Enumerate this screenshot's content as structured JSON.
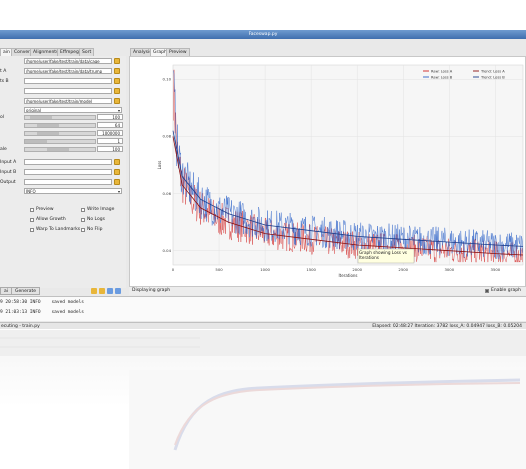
{
  "window": {
    "title": "Faceswap.py"
  },
  "left_tabs": [
    "ain",
    "Convert",
    "Alignments",
    "Effmpeg",
    "Sort"
  ],
  "right_tabs": [
    "Analysis",
    "Graph",
    "Preview"
  ],
  "fields": [
    {
      "label": "",
      "value": "/home/user/fake/test/train/data/cage"
    },
    {
      "label": "t A",
      "value": "/home/user/fake/test/train/data/trump"
    },
    {
      "label": "ts B",
      "value": ""
    },
    {
      "label": "",
      "value": ""
    },
    {
      "label": "",
      "value": "/home/user/fake/test/train/model"
    }
  ],
  "trainer_value": "original",
  "sliders": [
    {
      "label": "ol",
      "value": "100",
      "knob": 0.1
    },
    {
      "label": "",
      "value": "64",
      "knob": 0.25
    },
    {
      "label": "",
      "value": "1000000",
      "knob": 0.25
    },
    {
      "label": "",
      "value": "1",
      "knob": 0.0
    },
    {
      "label": "ale",
      "value": "100",
      "knob": 0.45
    }
  ],
  "io_fields": [
    {
      "label": "Input A",
      "value": ""
    },
    {
      "label": "Input B",
      "value": ""
    },
    {
      "label": "Output",
      "value": ""
    }
  ],
  "loglevel": "INFO",
  "checkboxes": [
    {
      "label": "Preview"
    },
    {
      "label": "Write Image"
    },
    {
      "label": "Allow Growth"
    },
    {
      "label": "No Logs"
    },
    {
      "label": "Warp To Landmarks"
    },
    {
      "label": "No Flip"
    }
  ],
  "buttons": {
    "train": "ai",
    "generate": "Generate"
  },
  "chart_data": {
    "type": "line",
    "title": "",
    "xlabel": "Iterations",
    "ylabel": "Loss",
    "xlim": [
      0,
      3800
    ],
    "ylim": [
      0.035,
      0.105
    ],
    "xticks": [
      "0",
      "500",
      "1000",
      "1500",
      "2000",
      "2500",
      "3000",
      "3500"
    ],
    "yticks": [
      "0.04",
      "0.06",
      "0.08",
      "0.10"
    ],
    "legend": [
      "Raw: Loss A",
      "Raw: Loss B",
      "Trend: Loss A",
      "Trend: Loss B"
    ],
    "tooltip": "Graph showing Loss vs Iterations",
    "series": [
      {
        "name": "Raw: Loss A",
        "color": "#d02020",
        "x": [
          0,
          50,
          100,
          200,
          300,
          500,
          700,
          1000,
          1500,
          2000,
          2500,
          3000,
          3500,
          3800
        ],
        "y": [
          0.1,
          0.072,
          0.064,
          0.058,
          0.055,
          0.051,
          0.049,
          0.046,
          0.044,
          0.042,
          0.041,
          0.04,
          0.039,
          0.0385
        ]
      },
      {
        "name": "Raw: Loss B",
        "color": "#2a60c8",
        "x": [
          0,
          50,
          100,
          200,
          300,
          500,
          700,
          1000,
          1500,
          2000,
          2500,
          3000,
          3500,
          3800
        ],
        "y": [
          0.098,
          0.074,
          0.067,
          0.061,
          0.058,
          0.054,
          0.052,
          0.049,
          0.047,
          0.045,
          0.044,
          0.043,
          0.042,
          0.0415
        ]
      },
      {
        "name": "Trend: Loss A",
        "color": "#8b1010",
        "x": [
          0,
          100,
          300,
          600,
          1000,
          1500,
          2000,
          2500,
          3000,
          3500,
          3800
        ],
        "y": [
          0.08,
          0.063,
          0.055,
          0.05,
          0.046,
          0.044,
          0.042,
          0.041,
          0.04,
          0.039,
          0.0385
        ]
      },
      {
        "name": "Trend: Loss B",
        "color": "#1a3d8c",
        "x": [
          0,
          100,
          300,
          600,
          1000,
          1500,
          2000,
          2500,
          3000,
          3500,
          3800
        ],
        "y": [
          0.082,
          0.066,
          0.058,
          0.053,
          0.049,
          0.047,
          0.045,
          0.044,
          0.043,
          0.042,
          0.0415
        ]
      }
    ]
  },
  "status": {
    "left": "Displaying graph",
    "right": "Enable graph"
  },
  "console_lines": [
    "9 20:58:30 INFO    saved models",
    "9 21:03:13 INFO    saved models"
  ],
  "bottombar": {
    "left": "ecuting - train.py",
    "right": "Elapsed: 02:48:27  Iteration: 3782  loss_A: 0.04947  loss_B: 0.05204"
  }
}
